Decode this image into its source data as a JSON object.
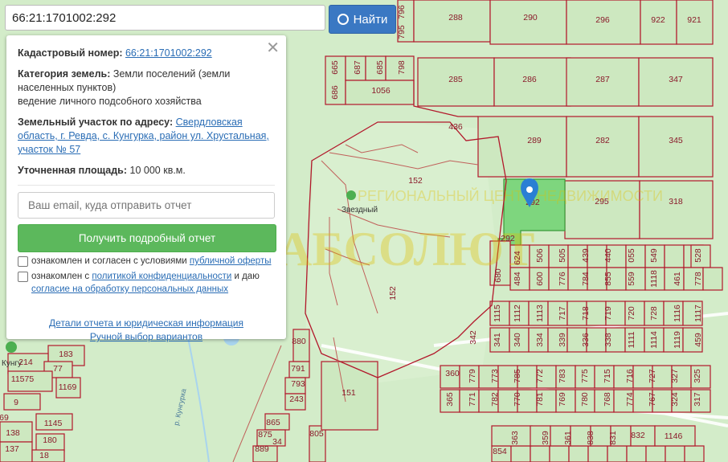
{
  "search": {
    "value": "66:21:1701002:292",
    "button_label": "Найти"
  },
  "panel": {
    "cad_label": "Кадастровый номер:",
    "cad_value": "66:21:1701002:292",
    "cat_label": "Категория земель:",
    "cat_value": "Земли поселений (земли населенных пунктов)",
    "use_value": "ведение личного подсобного хозяйства",
    "addr_label": "Земельный участок по адресу:",
    "addr_value": "Свердловская область, г. Ревда, с. Кунгурка, район ул. Хрустальная, участок № 57",
    "area_label": "Уточненная площадь:",
    "area_value": "10 000 кв.м.",
    "email_placeholder": "Ваш email, куда отправить отчет",
    "report_button": "Получить подробный отчет",
    "check1_text": "ознакомлен и согласен с условиями ",
    "check1_link": "публичной оферты",
    "check2_text": "ознакомлен с ",
    "check2_link1": "политикой конфиденциальности",
    "check2_mid": " и даю ",
    "check2_link2": "согласие на обработку персональных данных",
    "link_details": "Детали отчета и юридическая информация",
    "link_manual": "Ручной выбор вариантов"
  },
  "map": {
    "place_label": "Звездный",
    "place_label2": "Кунгу",
    "river_label": "р. Кунгурка",
    "watermark_top": "РЕГИОНАЛЬНЫЙ ЦЕНТР НЕДВИЖИМОСТИ",
    "watermark_main": "АБСОЛЮТ",
    "highlight_color": "#7ed67e",
    "marker_color": "#2a7fd4",
    "parcel_line_color": "#b2182b",
    "parcels": [
      "288",
      "290",
      "296",
      "922",
      "921",
      "796",
      "795",
      "665",
      "687",
      "685",
      "798",
      "285",
      "286",
      "287",
      "347",
      "686",
      "1056",
      "436",
      "289",
      "282",
      "345",
      "152",
      "292",
      "295",
      "318",
      "292",
      "624",
      "506",
      "505",
      "439",
      "440",
      "055",
      "549",
      "528",
      "680",
      "484",
      "600",
      "776",
      "784",
      "855",
      "559",
      "1118",
      "461",
      "778",
      "1115",
      "1112",
      "1113",
      "717",
      "718",
      "719",
      "720",
      "728",
      "1116",
      "1117",
      "342",
      "341",
      "340",
      "334",
      "339",
      "336",
      "338",
      "1111",
      "1114",
      "1119",
      "459",
      "152",
      "360",
      "779",
      "773",
      "785",
      "772",
      "783",
      "775",
      "715",
      "716",
      "727",
      "327",
      "325",
      "365",
      "771",
      "782",
      "770",
      "781",
      "769",
      "780",
      "768",
      "774",
      "767",
      "324",
      "317",
      "363",
      "359",
      "361",
      "838",
      "831",
      "832",
      "1146",
      "151",
      "854",
      "880",
      "791",
      "793",
      "243",
      "865",
      "875",
      "889",
      "805",
      "183",
      "214",
      "77",
      "11575",
      "1169",
      "9",
      "1145",
      "138",
      "180",
      "137",
      "18",
      "69",
      "34"
    ]
  }
}
